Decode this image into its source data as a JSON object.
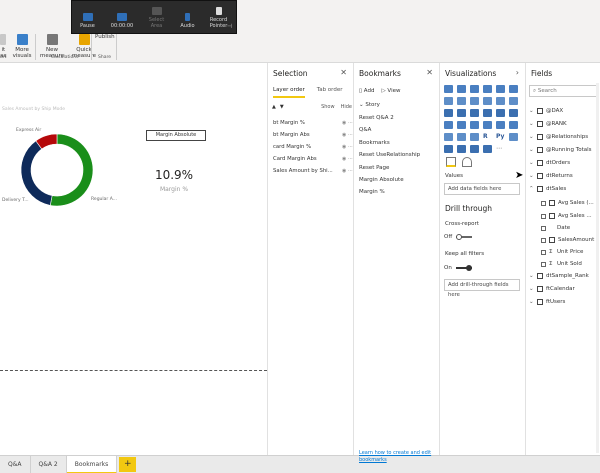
{
  "ribbon": {
    "partial_left_top": "it",
    "partial_left_bottom": "ax",
    "more_visuals": [
      "More",
      "visuals"
    ],
    "new_measure": [
      "New",
      "measure"
    ],
    "quick_measure": [
      "Quick",
      "measure"
    ],
    "publish": "Publish",
    "group_partial": "art",
    "group_calculations": "Calculations",
    "group_share": "Share"
  },
  "recording_toolbar": {
    "pause": "Pause",
    "timer": "00:00:00",
    "select_area": [
      "Select",
      "Area"
    ],
    "audio": "Audio",
    "record_pointer": [
      "Record",
      "Pointer"
    ]
  },
  "canvas": {
    "donut_title": "Sales Amount by Ship Mode",
    "labels": {
      "express": "Express Air",
      "delivery": "Delivery T...",
      "regular": "Regular A..."
    },
    "card": {
      "title": "Margin Absolute",
      "value": "10.9%",
      "label": "Margin %"
    }
  },
  "chart_data": {
    "type": "pie",
    "categories": [
      "Regular A...",
      "Delivery T...",
      "Express Air"
    ],
    "values": [
      53,
      37,
      10
    ],
    "colors": [
      "#1a8e1a",
      "#0e2a5a",
      "#b5080a"
    ]
  },
  "page_tabs": [
    "Q&A",
    "Q&A 2",
    "Bookmarks"
  ],
  "active_tab": "Bookmarks",
  "add_tab": "+",
  "selection": {
    "title": "Selection",
    "tabs": [
      "Layer order",
      "Tab order"
    ],
    "show": "Show",
    "hide": "Hide",
    "items": [
      "bt Margin %",
      "bt Margin Abs",
      "card Margin %",
      "Card Margin Abs",
      "Sales Amount by Shi..."
    ]
  },
  "bookmarks": {
    "title": "Bookmarks",
    "add": "Add",
    "view": "View",
    "group": "Story",
    "items": [
      "Reset Q&A 2",
      "Q&A",
      "Bookmarks",
      "Reset UseRelationship",
      "Reset Page",
      "Margin Absolute",
      "Margin %"
    ],
    "learn_link": "Learn how to create and edit bookmarks"
  },
  "visualizations": {
    "title": "Visualizations",
    "values_label": "Values",
    "values_placeholder": "Add data fields here",
    "drill_through": "Drill through",
    "cross_report": "Cross-report",
    "cross_report_state": "Off",
    "keep_filters": "Keep all filters",
    "keep_filters_state": "On",
    "drill_placeholder": "Add drill-through fields here",
    "r_icon": "R",
    "py_icon": "Py"
  },
  "fields": {
    "title": "Fields",
    "search_placeholder": "Search",
    "tables": [
      "@DAX",
      "@RANK",
      "@Relationships",
      "@Running Totals",
      "dtOrders",
      "dtReturns",
      "dtSales"
    ],
    "dtSales_fields": [
      "Avg Sales (...",
      "Avg Sales ...",
      "Date",
      "SalesAmount",
      "Unit Price",
      "Unit Sold"
    ],
    "tables_after": [
      "dtSample_Rank",
      "ftCalendar",
      "ftUsers"
    ]
  }
}
